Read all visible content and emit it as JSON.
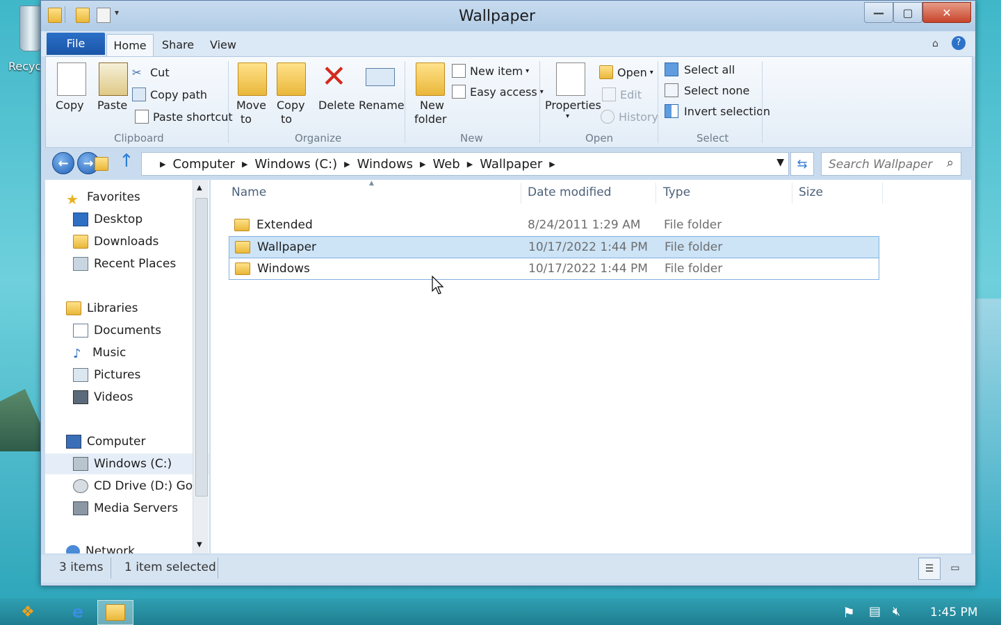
{
  "desktop": {
    "recycle_label": "Recyc"
  },
  "window": {
    "title": "Wallpaper"
  },
  "ribbon_tabs": [
    "File",
    "Home",
    "Share",
    "View"
  ],
  "ribbon": {
    "clipboard": {
      "copy": "Copy",
      "paste": "Paste",
      "cut": "Cut",
      "copy_path": "Copy path",
      "paste_shortcut": "Paste shortcut",
      "group": "Clipboard"
    },
    "organize": {
      "move_to_1": "Move",
      "move_to_2": "to",
      "copy_to_1": "Copy",
      "copy_to_2": "to",
      "delete": "Delete",
      "rename": "Rename",
      "group": "Organize"
    },
    "new": {
      "new_folder_1": "New",
      "new_folder_2": "folder",
      "new_item": "New item",
      "easy_access": "Easy access",
      "group": "New"
    },
    "open": {
      "properties": "Properties",
      "open": "Open",
      "edit": "Edit",
      "history": "History",
      "group": "Open"
    },
    "select": {
      "select_all": "Select all",
      "select_none": "Select none",
      "invert": "Invert selection",
      "group": "Select"
    }
  },
  "address": {
    "crumbs": [
      "Computer",
      "Windows (C:)",
      "Windows",
      "Web",
      "Wallpaper"
    ]
  },
  "search": {
    "placeholder": "Search Wallpaper"
  },
  "nav": {
    "favorites": "Favorites",
    "desktop": "Desktop",
    "downloads": "Downloads",
    "recent": "Recent Places",
    "libraries": "Libraries",
    "documents": "Documents",
    "music": "Music",
    "pictures": "Pictures",
    "videos": "Videos",
    "computer": "Computer",
    "windows_c": "Windows (C:)",
    "cd_drive": "CD Drive (D:) Goo",
    "media_servers": "Media Servers",
    "network": "Network"
  },
  "columns": {
    "name": "Name",
    "date": "Date modified",
    "type": "Type",
    "size": "Size"
  },
  "files": [
    {
      "name": "Extended",
      "date": "8/24/2011 1:29 AM",
      "type": "File folder",
      "selected": false
    },
    {
      "name": "Wallpaper",
      "date": "10/17/2022 1:44 PM",
      "type": "File folder",
      "selected": true
    },
    {
      "name": "Windows",
      "date": "10/17/2022 1:44 PM",
      "type": "File folder",
      "selected": false
    }
  ],
  "status": {
    "count": "3 items",
    "selected": "1 item selected"
  },
  "taskbar": {
    "clock": "1:45 PM"
  }
}
